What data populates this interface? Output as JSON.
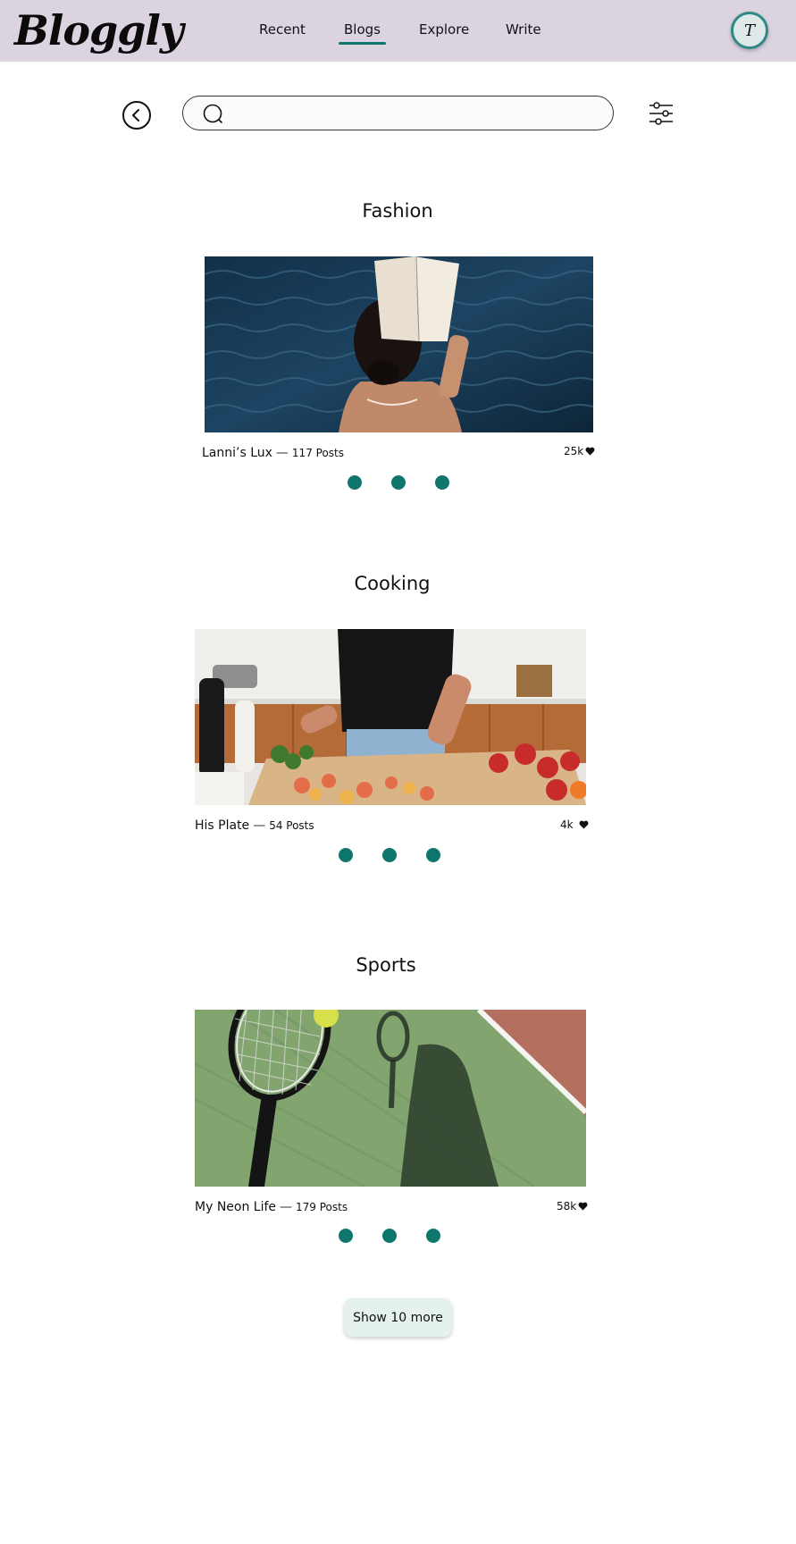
{
  "header": {
    "logo": "Bloggly",
    "nav": [
      {
        "label": "Recent",
        "active": false
      },
      {
        "label": "Blogs",
        "active": true
      },
      {
        "label": "Explore",
        "active": false
      },
      {
        "label": "Write",
        "active": false
      }
    ],
    "avatar_initial": "T"
  },
  "search": {
    "value": "",
    "placeholder": ""
  },
  "icons": {
    "back": "chevron-left-circle-icon",
    "search": "search-icon",
    "filter": "sliders-icon",
    "like": "heart-icon"
  },
  "colors": {
    "header_bg": "#dcd3e0",
    "accent": "#0f766e",
    "button_bg": "#e4f1ef"
  },
  "sections": [
    {
      "title": "Fashion",
      "card": {
        "name": "Lanni’s Lux",
        "posts": "117 Posts",
        "likes": "25k"
      },
      "pagination_dots": 3
    },
    {
      "title": "Cooking",
      "card": {
        "name": "His Plate",
        "posts": "54 Posts",
        "likes": "4k"
      },
      "pagination_dots": 3
    },
    {
      "title": "Sports",
      "card": {
        "name": "My Neon Life",
        "posts": "179 Posts",
        "likes": "58k"
      },
      "pagination_dots": 3
    }
  ],
  "show_more_label": "Show 10 more"
}
